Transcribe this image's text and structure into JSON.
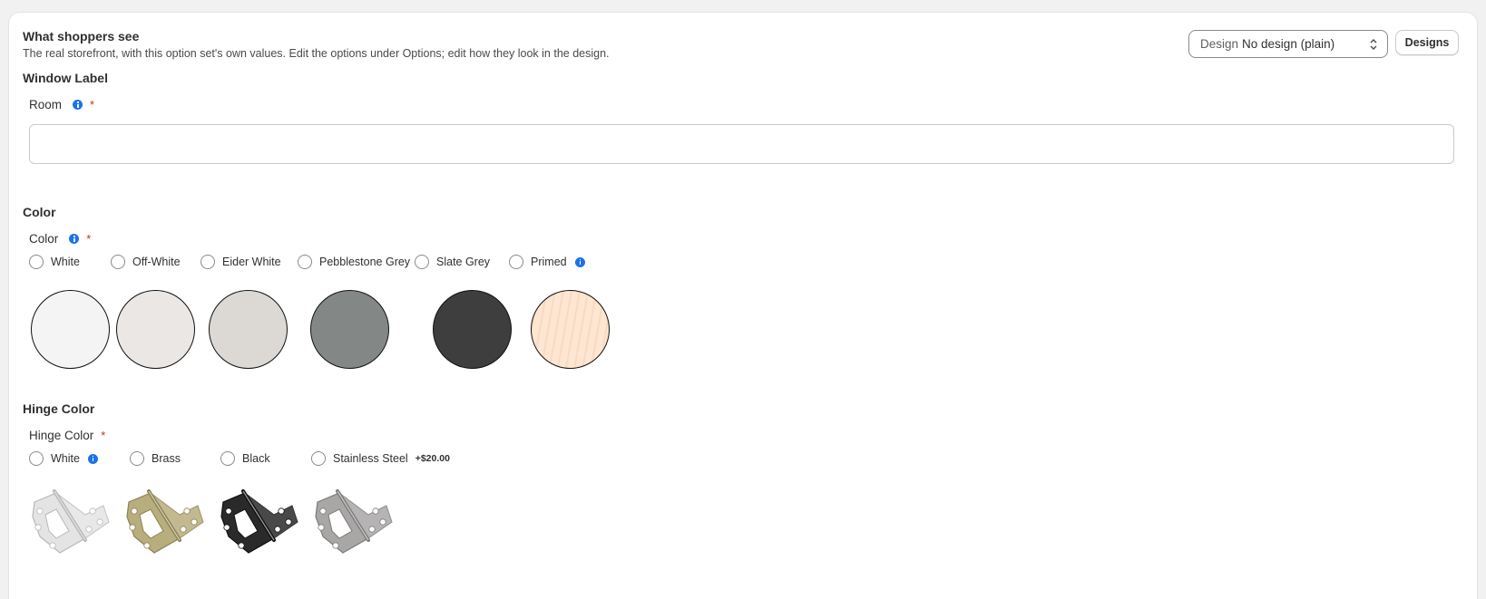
{
  "header": {
    "title": "What shoppers see",
    "subtitle": "The real storefront, with this option set's own values. Edit the options under Options; edit how they look in the design.",
    "design_label": "Design",
    "design_value": "No design (plain)",
    "designs_button": "Designs"
  },
  "window_label": {
    "section_title": "Window Label",
    "field_label": "Room",
    "required_mark": "*",
    "input_value": ""
  },
  "color": {
    "section_title": "Color",
    "field_label": "Color",
    "required_mark": "*",
    "options": [
      {
        "label": "White",
        "swatch": "#f4f4f4"
      },
      {
        "label": "Off-White",
        "swatch": "#ebe7e4"
      },
      {
        "label": "Eider White",
        "swatch": "#dcd8d3"
      },
      {
        "label": "Pebblestone Grey",
        "swatch": "#838886"
      },
      {
        "label": "Slate Grey",
        "swatch": "#3f3e3f"
      },
      {
        "label": "Primed",
        "swatch": "#fde6d2"
      }
    ]
  },
  "hinge_color": {
    "section_title": "Hinge Color",
    "field_label": "Hinge Color",
    "required_mark": "*",
    "options": [
      {
        "label": "White",
        "price": "",
        "plate": "#e4e4e4",
        "edge": "#b8b8b8"
      },
      {
        "label": "Brass",
        "price": "",
        "plate": "#b8ad7c",
        "edge": "#8c8253"
      },
      {
        "label": "Black",
        "price": "",
        "plate": "#2a2a2a",
        "edge": "#111111"
      },
      {
        "label": "Stainless Steel",
        "price": "+$20.00",
        "plate": "#a9a6a6",
        "edge": "#7d7a7a"
      }
    ]
  },
  "colors": {
    "info_blue": "#1a73e8",
    "required_red": "#d72c0d"
  }
}
